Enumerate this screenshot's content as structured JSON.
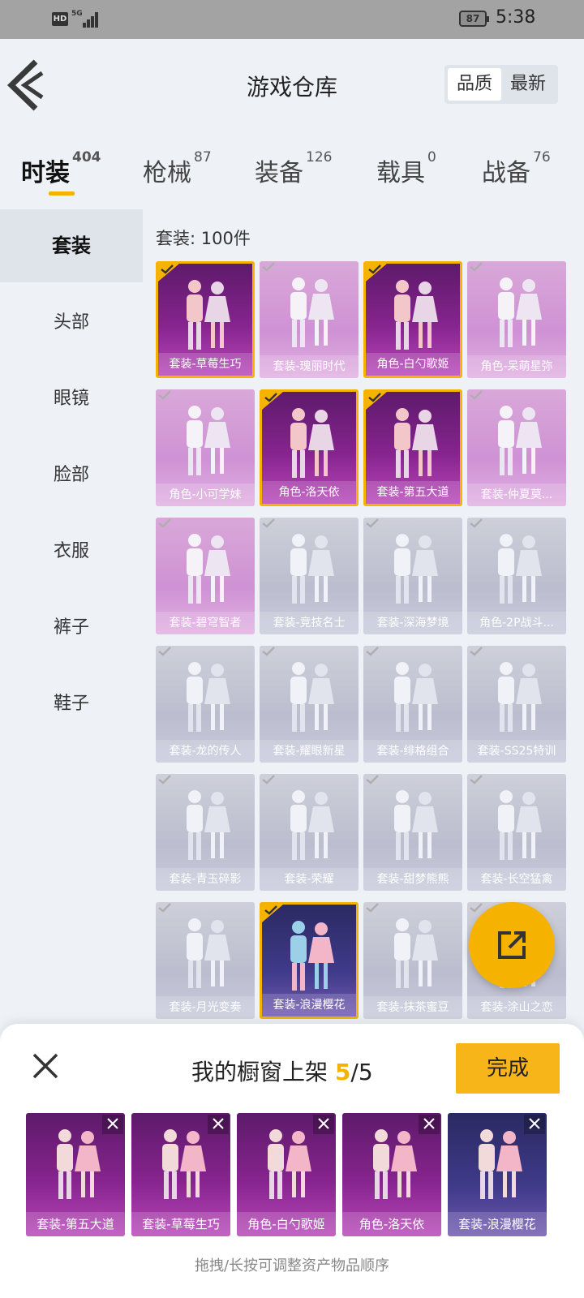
{
  "status_bar": {
    "network": "HD",
    "signal_type": "5G",
    "battery": "87",
    "time": "5:38"
  },
  "header": {
    "title": "游戏仓库",
    "sort_options": [
      "品质",
      "最新"
    ],
    "active_sort": "品质"
  },
  "tabs": [
    {
      "label": "时装",
      "count": "404",
      "active": true
    },
    {
      "label": "枪械",
      "count": "87"
    },
    {
      "label": "装备",
      "count": "126"
    },
    {
      "label": "载具",
      "count": "0"
    },
    {
      "label": "战备",
      "count": "76"
    }
  ],
  "sidebar": {
    "items": [
      "套装",
      "头部",
      "眼镜",
      "脸部",
      "衣服",
      "裤子",
      "鞋子"
    ],
    "active": "套装"
  },
  "grid": {
    "count_label": "套装: 100件",
    "items": [
      {
        "name": "套装-草莓生巧",
        "selected": true,
        "tone": "dpurple"
      },
      {
        "name": "套装-瑰丽时代",
        "selected": false,
        "tone": "purple"
      },
      {
        "name": "角色-白勺歌姬",
        "selected": true,
        "tone": "dpurple"
      },
      {
        "name": "角色-呆萌星弥",
        "selected": false,
        "tone": "purple"
      },
      {
        "name": "角色-小可学妹",
        "selected": false,
        "tone": "purple"
      },
      {
        "name": "角色-洛天依",
        "selected": true,
        "tone": "dpurple"
      },
      {
        "name": "套装-第五大道",
        "selected": true,
        "tone": "dpurple"
      },
      {
        "name": "套装-仲夏莫...",
        "selected": false,
        "tone": "purple"
      },
      {
        "name": "套装-碧穹智者",
        "selected": false,
        "tone": "purple"
      },
      {
        "name": "套装-竞技名士",
        "selected": false,
        "tone": "gray"
      },
      {
        "name": "套装-深海梦境",
        "selected": false,
        "tone": "gray"
      },
      {
        "name": "角色-2P战斗...",
        "selected": false,
        "tone": "gray"
      },
      {
        "name": "套装-龙的传人",
        "selected": false,
        "tone": "gray"
      },
      {
        "name": "套装-耀眼新星",
        "selected": false,
        "tone": "gray"
      },
      {
        "name": "套装-绯格组合",
        "selected": false,
        "tone": "gray"
      },
      {
        "name": "套装-SS25特训",
        "selected": false,
        "tone": "gray"
      },
      {
        "name": "套装-青玉碎影",
        "selected": false,
        "tone": "gray"
      },
      {
        "name": "套装-荣耀",
        "selected": false,
        "tone": "gray"
      },
      {
        "name": "套装-甜梦熊熊",
        "selected": false,
        "tone": "gray"
      },
      {
        "name": "套装-长空猛禽",
        "selected": false,
        "tone": "gray"
      },
      {
        "name": "套装-月光变奏",
        "selected": false,
        "tone": "gray"
      },
      {
        "name": "套装-浪漫樱花",
        "selected": true,
        "tone": "blue"
      },
      {
        "name": "套装-抹茶蜜豆",
        "selected": false,
        "tone": "gray"
      },
      {
        "name": "套装-涂山之恋",
        "selected": false,
        "tone": "gray"
      }
    ]
  },
  "showcase": {
    "title": "我的橱窗上架",
    "current": "5",
    "separator": "/",
    "max": "5",
    "done_label": "完成",
    "slots": [
      {
        "name": "套装-第五大道",
        "tone": "dpurple"
      },
      {
        "name": "套装-草莓生巧",
        "tone": "dpurple"
      },
      {
        "name": "角色-白勺歌姬",
        "tone": "dpurple"
      },
      {
        "name": "角色-洛天依",
        "tone": "dpurple"
      },
      {
        "name": "套装-浪漫樱花",
        "tone": "blue"
      }
    ],
    "hint": "拖拽/长按可调整资产物品顺序"
  },
  "colors": {
    "accent": "#f5b300",
    "selected_border": "#f5b300",
    "background": "#eef2f7"
  }
}
